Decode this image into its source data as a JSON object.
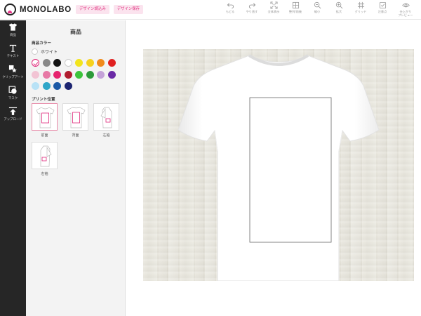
{
  "app": {
    "logo_text": "MONOLABO",
    "load_design_label": "デザイン読込み",
    "save_design_label": "デザイン保存"
  },
  "toolbar": [
    {
      "icon": "undo-icon",
      "label": "もどる"
    },
    {
      "icon": "redo-icon",
      "label": "やり直す"
    },
    {
      "icon": "fit-screen-icon",
      "label": "全体表示"
    },
    {
      "icon": "grid-snap-icon",
      "label": "整列/前後"
    },
    {
      "icon": "zoom-out-icon",
      "label": "縮小"
    },
    {
      "icon": "zoom-in-icon",
      "label": "拡大"
    },
    {
      "icon": "grid-icon",
      "label": "グリッド"
    },
    {
      "icon": "confirm-icon",
      "label": "注意点"
    },
    {
      "icon": "preview-icon",
      "label": "仕上がり\nプレビュー"
    }
  ],
  "sidebar": {
    "items": [
      {
        "icon": "tshirt-icon",
        "label": "商品"
      },
      {
        "icon": "text-icon",
        "label": "テキスト"
      },
      {
        "icon": "clipart-icon",
        "label": "クリップアート"
      },
      {
        "icon": "mask-icon",
        "label": "マスク"
      },
      {
        "icon": "upload-icon",
        "label": "アップロード"
      }
    ]
  },
  "panel": {
    "title": "商品",
    "color_section_label": "商品カラー",
    "selected_color_name": "ホワイト",
    "colors": [
      "#ffffff",
      "#888888",
      "#111111",
      "#ffffff",
      "#f2e41c",
      "#f6d11c",
      "#f08a1c",
      "#e02020",
      "#f2c4d4",
      "#e77aa6",
      "#e6246e",
      "#b01c2e",
      "#3cc43c",
      "#2c9a3a",
      "#c4a2d8",
      "#6a2aa6",
      "#b8e2f6",
      "#2fa6c8",
      "#1c5aa6",
      "#1c2470"
    ],
    "position_section_label": "プリント位置",
    "positions": [
      {
        "label": "前面",
        "selected": true
      },
      {
        "label": "背面",
        "selected": false
      },
      {
        "label": "左袖",
        "selected": false
      },
      {
        "label": "右袖",
        "selected": false
      }
    ]
  }
}
